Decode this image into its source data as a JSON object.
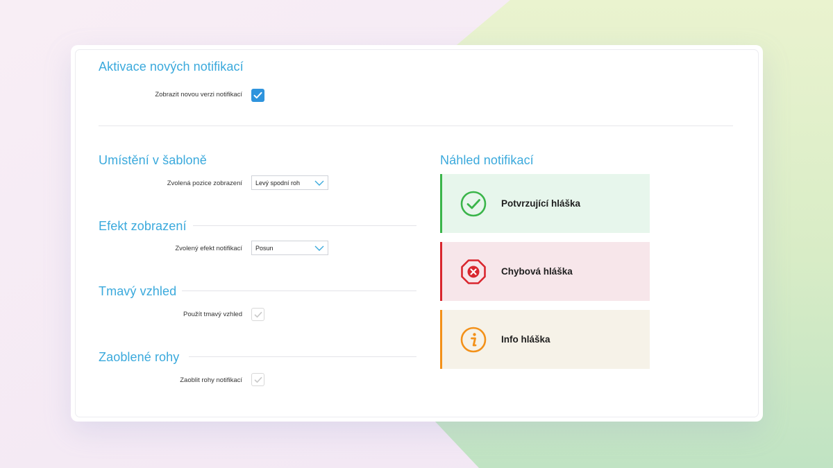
{
  "activation": {
    "title": "Aktivace nových notifikací",
    "show_new_label": "Zobrazit novou verzi notifikací",
    "show_new_checked": true
  },
  "placement": {
    "title": "Umístění v šabloně",
    "position_label": "Zvolená pozice zobrazení",
    "position_value": "Levý spodní roh"
  },
  "effect": {
    "title": "Efekt zobrazení",
    "effect_label": "Zvolený efekt notifikací",
    "effect_value": "Posun"
  },
  "dark": {
    "title": "Tmavý vzhled",
    "use_dark_label": "Použít tmavý vzhled",
    "use_dark_checked": true
  },
  "rounded": {
    "title": "Zaoblené rohy",
    "round_label": "Zaoblit rohy notifikací",
    "round_checked": true
  },
  "preview": {
    "title": "Náhled notifikací",
    "success": {
      "text": "Potvrzující hláška",
      "accent": "#3ab54a",
      "bg": "#e7f6ec",
      "icon": "check-circle-icon"
    },
    "error": {
      "text": "Chybová hláška",
      "accent": "#d9262e",
      "bg": "#f7e6ea",
      "icon": "x-octagon-icon"
    },
    "info": {
      "text": "Info hláška",
      "accent": "#f39119",
      "bg": "#f6f2e8",
      "icon": "info-circle-icon"
    }
  },
  "colors": {
    "heading": "#3aa9dc",
    "checkbox_active": "#2f94dd"
  }
}
